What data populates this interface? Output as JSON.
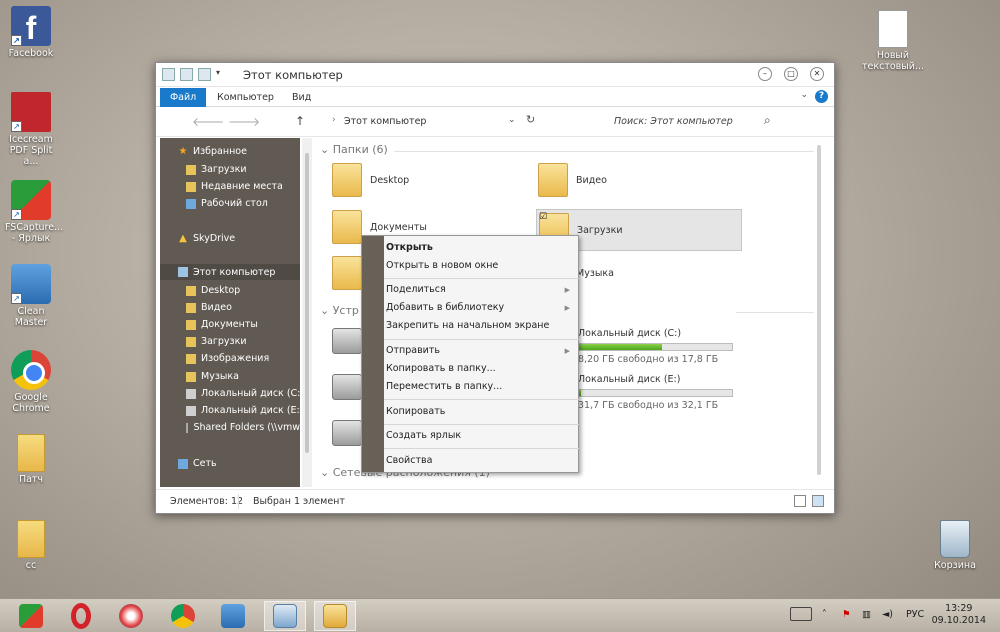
{
  "desktop": {
    "icons": [
      {
        "label": "Facebook"
      },
      {
        "label": "Icecream PDF Split a..."
      },
      {
        "label": "FSCapture... - Ярлык"
      },
      {
        "label": "Clean Master"
      },
      {
        "label": "Google Chrome"
      },
      {
        "label": "Патч"
      },
      {
        "label": "cc"
      },
      {
        "label": "Новый текстовый..."
      },
      {
        "label": "Корзина"
      }
    ]
  },
  "window": {
    "title": "Этот компьютер",
    "ribbon_tabs": [
      "Файл",
      "Компьютер",
      "Вид"
    ],
    "help": "?",
    "address": "Этот компьютер",
    "search_placeholder": "Поиск: Этот компьютер",
    "nav": {
      "favorites": "Избранное",
      "fav_items": [
        "Загрузки",
        "Недавние места",
        "Рабочий стол"
      ],
      "skydrive": "SkyDrive",
      "this_pc": "Этот компьютер",
      "pc_items": [
        "Desktop",
        "Видео",
        "Документы",
        "Загрузки",
        "Изображения",
        "Музыка",
        "Локальный диск (C:)",
        "Локальный диск (E:)",
        "Shared Folders (\\\\vmw"
      ],
      "network": "Сеть"
    },
    "groups": {
      "folders": "Папки (6)",
      "devices": "Устр",
      "network_locations": "Сетевые расположения (1)"
    },
    "folders": [
      "Desktop",
      "Видео",
      "Документы",
      "Загрузки",
      "Музыка"
    ],
    "drives": [
      {
        "name": "Локальный диск (C:)",
        "free": "8,20 ГБ свободно из 17,8 ГБ",
        "used_fraction": 0.54
      },
      {
        "name": "Локальный диск (E:)",
        "free": "31,7 ГБ свободно из 32,1 ГБ",
        "used_fraction": 0.01
      }
    ],
    "status": {
      "items": "Элементов: 12",
      "selected": "Выбран 1 элемент"
    }
  },
  "context_menu": {
    "open": "Открыть",
    "open_new": "Открыть в новом окне",
    "share": "Поделиться",
    "add_library": "Добавить в библиотеку",
    "pin_start": "Закрепить на начальном экране",
    "send_to": "Отправить",
    "copy_to": "Копировать в папку...",
    "move_to": "Переместить в папку...",
    "copy": "Копировать",
    "create_shortcut": "Создать ярлык",
    "properties": "Свойства"
  },
  "taskbar": {
    "lang": "РУС",
    "time": "13:29",
    "date": "09.10.2014"
  }
}
